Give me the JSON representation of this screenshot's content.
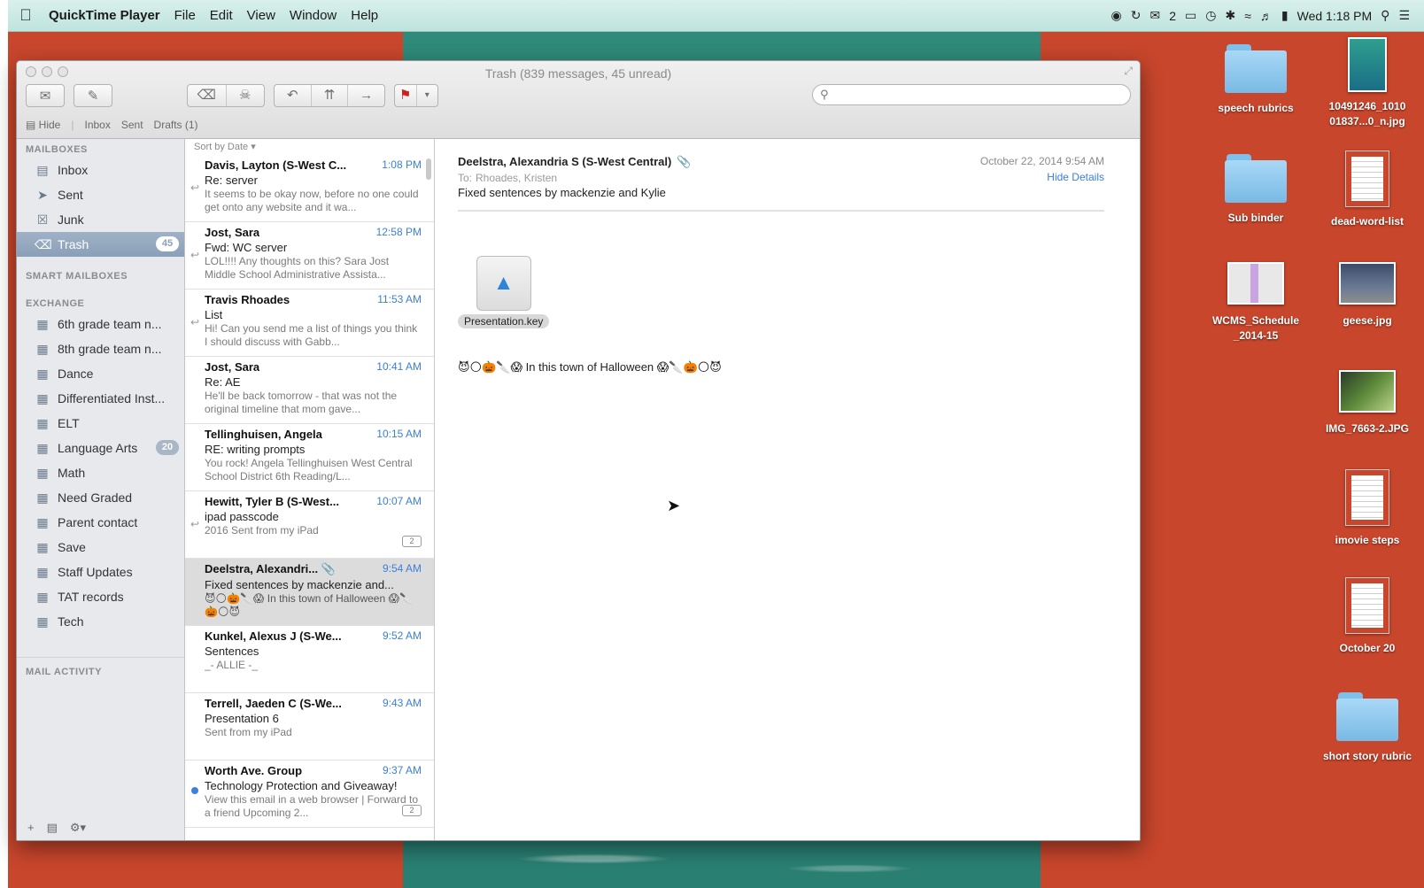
{
  "menubar": {
    "app_name": "QuickTime Player",
    "menus": [
      "File",
      "Edit",
      "View",
      "Window",
      "Help"
    ],
    "status_text": "2",
    "clock": "Wed 1:18 PM"
  },
  "window": {
    "title": "Trash (839 messages, 45 unread)",
    "favorites": {
      "hide": "Hide",
      "inbox": "Inbox",
      "sent": "Sent",
      "drafts": "Drafts (1)"
    },
    "search": {
      "value": "",
      "placeholder": ""
    }
  },
  "sidebar": {
    "mailboxes_heading": "MAILBOXES",
    "mailboxes": [
      {
        "label": "Inbox",
        "icon": "inbox-icon"
      },
      {
        "label": "Sent",
        "icon": "sent-icon"
      },
      {
        "label": "Junk",
        "icon": "junk-icon"
      },
      {
        "label": "Trash",
        "icon": "trash-icon",
        "badge": "45"
      }
    ],
    "smart_heading": "SMART MAILBOXES",
    "exchange_heading": "EXCHANGE",
    "folders": [
      {
        "label": "6th grade team n..."
      },
      {
        "label": "8th grade team n..."
      },
      {
        "label": "Dance"
      },
      {
        "label": "Differentiated Inst..."
      },
      {
        "label": "ELT"
      },
      {
        "label": "Language Arts",
        "badge": "20"
      },
      {
        "label": "Math"
      },
      {
        "label": "Need Graded"
      },
      {
        "label": "Parent contact"
      },
      {
        "label": "Save"
      },
      {
        "label": "Staff Updates"
      },
      {
        "label": "TAT records"
      },
      {
        "label": "Tech"
      }
    ],
    "activity_heading": "MAIL ACTIVITY"
  },
  "list": {
    "sort_label": "Sort by Date ▾",
    "messages": [
      {
        "from": "Davis, Layton (S-West C...",
        "time": "1:08 PM",
        "subject": "Re: server",
        "preview": "It seems to be okay now, before no one could get onto any website and it wa..."
      },
      {
        "from": "Jost, Sara",
        "time": "12:58 PM",
        "subject": "Fwd: WC server",
        "preview": "LOL!!!! Any thoughts on this? Sara Jost Middle School Administrative Assista..."
      },
      {
        "from": "Travis Rhoades",
        "time": "11:53 AM",
        "subject": "List",
        "preview": "Hi! Can you send me a list of things you think I should discuss with Gabb..."
      },
      {
        "from": "Jost, Sara",
        "time": "10:41 AM",
        "subject": "Re: AE",
        "preview": "He'll be back tomorrow - that was not the original timeline that mom gave..."
      },
      {
        "from": "Tellinghuisen, Angela",
        "time": "10:15 AM",
        "subject": "RE: writing prompts",
        "preview": "You rock! Angela Tellinghuisen West Central School District 6th Reading/L..."
      },
      {
        "from": "Hewitt, Tyler B (S-West...",
        "time": "10:07 AM",
        "subject": "ipad passcode",
        "preview": "2016 Sent from my iPad",
        "pill": "2"
      },
      {
        "from": "Deelstra, Alexandri...",
        "time": "9:54 AM",
        "subject": "Fixed sentences by mackenzie and...",
        "preview": "😈🌕🎃🔪😱 In this town of Halloween 😱🔪🎃🌕😈"
      },
      {
        "from": "Kunkel, Alexus J (S-We...",
        "time": "9:52 AM",
        "subject": "Sentences",
        "preview": "_- ALLIE -_"
      },
      {
        "from": "Terrell, Jaeden C (S-We...",
        "time": "9:43 AM",
        "subject": "Presentation 6",
        "preview": "Sent from my iPad"
      },
      {
        "from": "Worth Ave. Group",
        "time": "9:37 AM",
        "subject": "Technology Protection and Giveaway!",
        "preview": "View this email in a web browser | Forward to a friend Upcoming 2...",
        "pill": "2"
      }
    ]
  },
  "reader": {
    "sender": "Deelstra, Alexandria S (S-West Central)",
    "to_label": "To:",
    "to": "Rhoades, Kristen",
    "subject": "Fixed sentences by mackenzie and Kylie",
    "date": "October 22, 2014 9:54 AM",
    "hide_details": "Hide Details",
    "attachment": "Presentation.key",
    "body": "😈🌕🎃🔪😱 In this town of Halloween 😱🔪🎃🌕😈"
  },
  "desktop": {
    "icons": [
      {
        "label": "speech rubrics"
      },
      {
        "label": "10491246_1010 01837...0_n.jpg"
      },
      {
        "label": "Sub binder"
      },
      {
        "label": "dead-word-list"
      },
      {
        "label": "WCMS_Schedule _2014-15"
      },
      {
        "label": "geese.jpg"
      },
      {
        "label": "IMG_7663-2.JPG"
      },
      {
        "label": "imovie steps"
      },
      {
        "label": "October 20"
      },
      {
        "label": "short story rubric"
      }
    ]
  },
  "colors": {
    "desktop_red": "#c8462c",
    "sea_green": "#2c7d71",
    "selection_blue": "#8aa0b8",
    "link_blue": "#3b7fd8"
  }
}
